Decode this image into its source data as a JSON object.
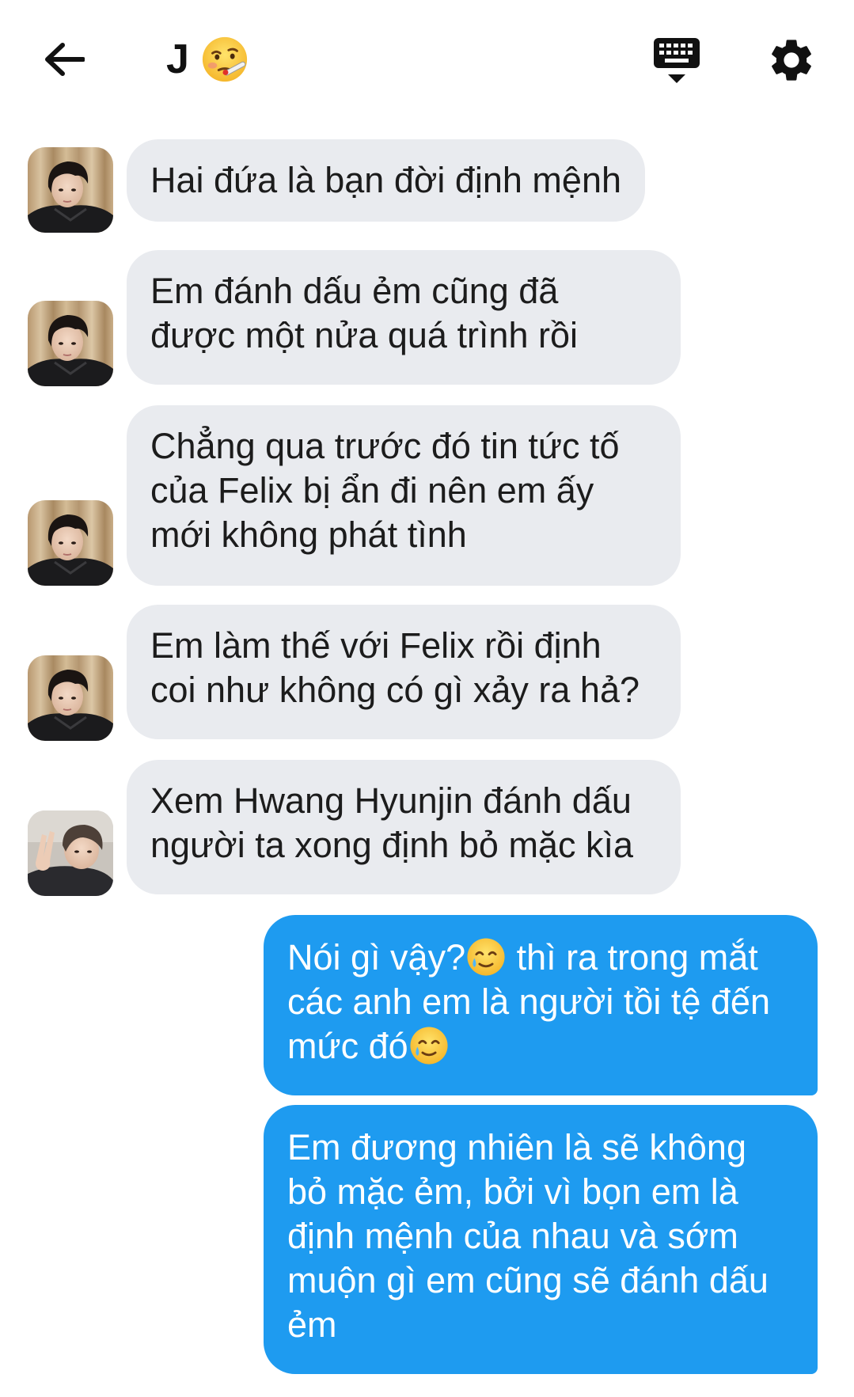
{
  "header": {
    "back_icon": "arrow-left-icon",
    "title": "J",
    "title_emoji": "face-with-thermometer-emoji",
    "keyboard_icon": "keyboard-hide-icon",
    "settings_icon": "gear-icon"
  },
  "colors": {
    "incoming_bubble": "#e9ebef",
    "outgoing_bubble": "#1e9bf0",
    "text_dark": "#1c1c1c",
    "text_light": "#ffffff"
  },
  "messages": [
    {
      "direction": "in",
      "avatar": "avatar-boy-dark-hair",
      "text": "Hai đứa là bạn đời định mệnh"
    },
    {
      "direction": "in",
      "avatar": "avatar-boy-dark-hair",
      "text": "Em đánh dấu ẻm cũng đã\nđược một nửa quá trình rồi"
    },
    {
      "direction": "in",
      "avatar": "avatar-boy-dark-hair",
      "text": "Chẳng qua trước đó tin tức tố\ncủa Felix bị ẩn đi nên em ấy\nmới không phát tình"
    },
    {
      "direction": "in",
      "avatar": "avatar-boy-dark-hair",
      "text": "Em làm thế với Felix rồi định\ncoi như không có gì xảy ra hả?"
    },
    {
      "direction": "in",
      "avatar": "avatar-boy-peace-sign",
      "text": "Xem Hwang Hyunjin đánh dấu\nngười ta xong định bỏ mặc kìa"
    },
    {
      "direction": "out",
      "text_part1": "Nói gì vậy?",
      "emoji1": "smiling-face-with-tear-emoji",
      "text_part2": " thì ra trong mắt\ncác anh em là người tồi tệ đến\nmức đó",
      "emoji2": "smiling-face-with-tear-emoji"
    },
    {
      "direction": "out",
      "text": "Em đương nhiên là sẽ không\nbỏ mặc ẻm, bởi vì bọn em là\nđịnh mệnh của nhau và sớm\nmuộn gì em cũng sẽ đánh dấu\nẻm"
    }
  ]
}
